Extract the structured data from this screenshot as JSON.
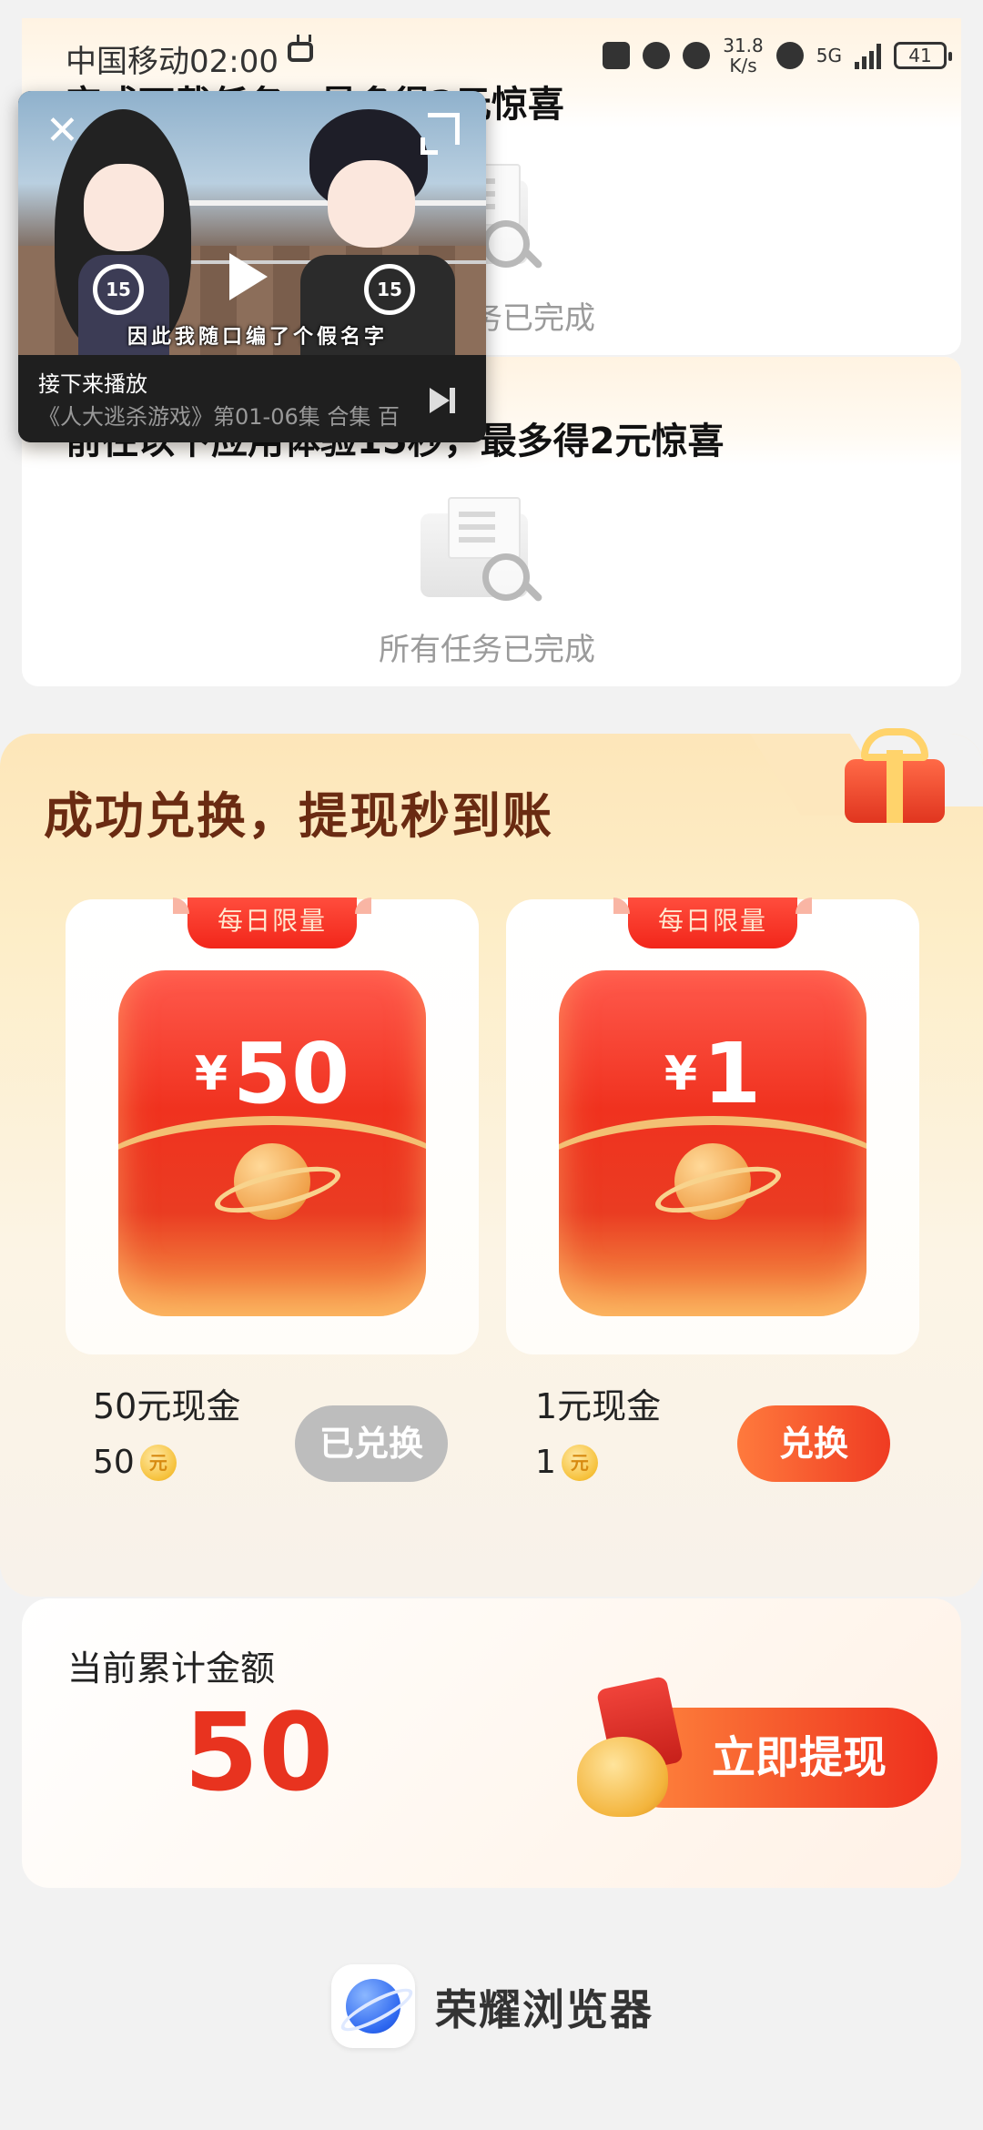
{
  "status_bar": {
    "carrier_time": "中国移动02:00",
    "net_speed_value": "31.8",
    "net_speed_unit": "K/s",
    "network_type": "5G",
    "battery_level": "41"
  },
  "task_cards": [
    {
      "title": "完成下载任务，最多得2元惊喜",
      "empty_text": "所有任务已完成"
    },
    {
      "title": "前往以下应用体验15秒，最多得2元惊喜",
      "empty_text": "所有任务已完成"
    }
  ],
  "video": {
    "subtitle": "因此我随口编了个假名字",
    "skip_back_label": "15",
    "skip_forward_label": "15",
    "next_label": "接下来播放",
    "next_title": "《人大逃杀游戏》第01-06集 合集 百"
  },
  "exchange": {
    "heading": "成功兑换，提现秒到账",
    "items": [
      {
        "badge": "每日限量",
        "yen": "¥",
        "amount": "50",
        "name": "50元现金",
        "price": "50",
        "coin_glyph": "元",
        "button": "已兑换",
        "state": "redeemed"
      },
      {
        "badge": "每日限量",
        "yen": "¥",
        "amount": "1",
        "name": "1元现金",
        "price": "1",
        "coin_glyph": "元",
        "button": "兑换",
        "state": "available"
      }
    ]
  },
  "total": {
    "label": "当前累计金额",
    "amount": "50",
    "withdraw_button": "立即提现"
  },
  "footer": {
    "app_name": "荣耀浏览器"
  },
  "colors": {
    "accent_red": "#ef3b22",
    "heading_brown": "#6a2b12",
    "amount_red": "#e8331f",
    "disabled_gray": "#bdbdbd"
  }
}
